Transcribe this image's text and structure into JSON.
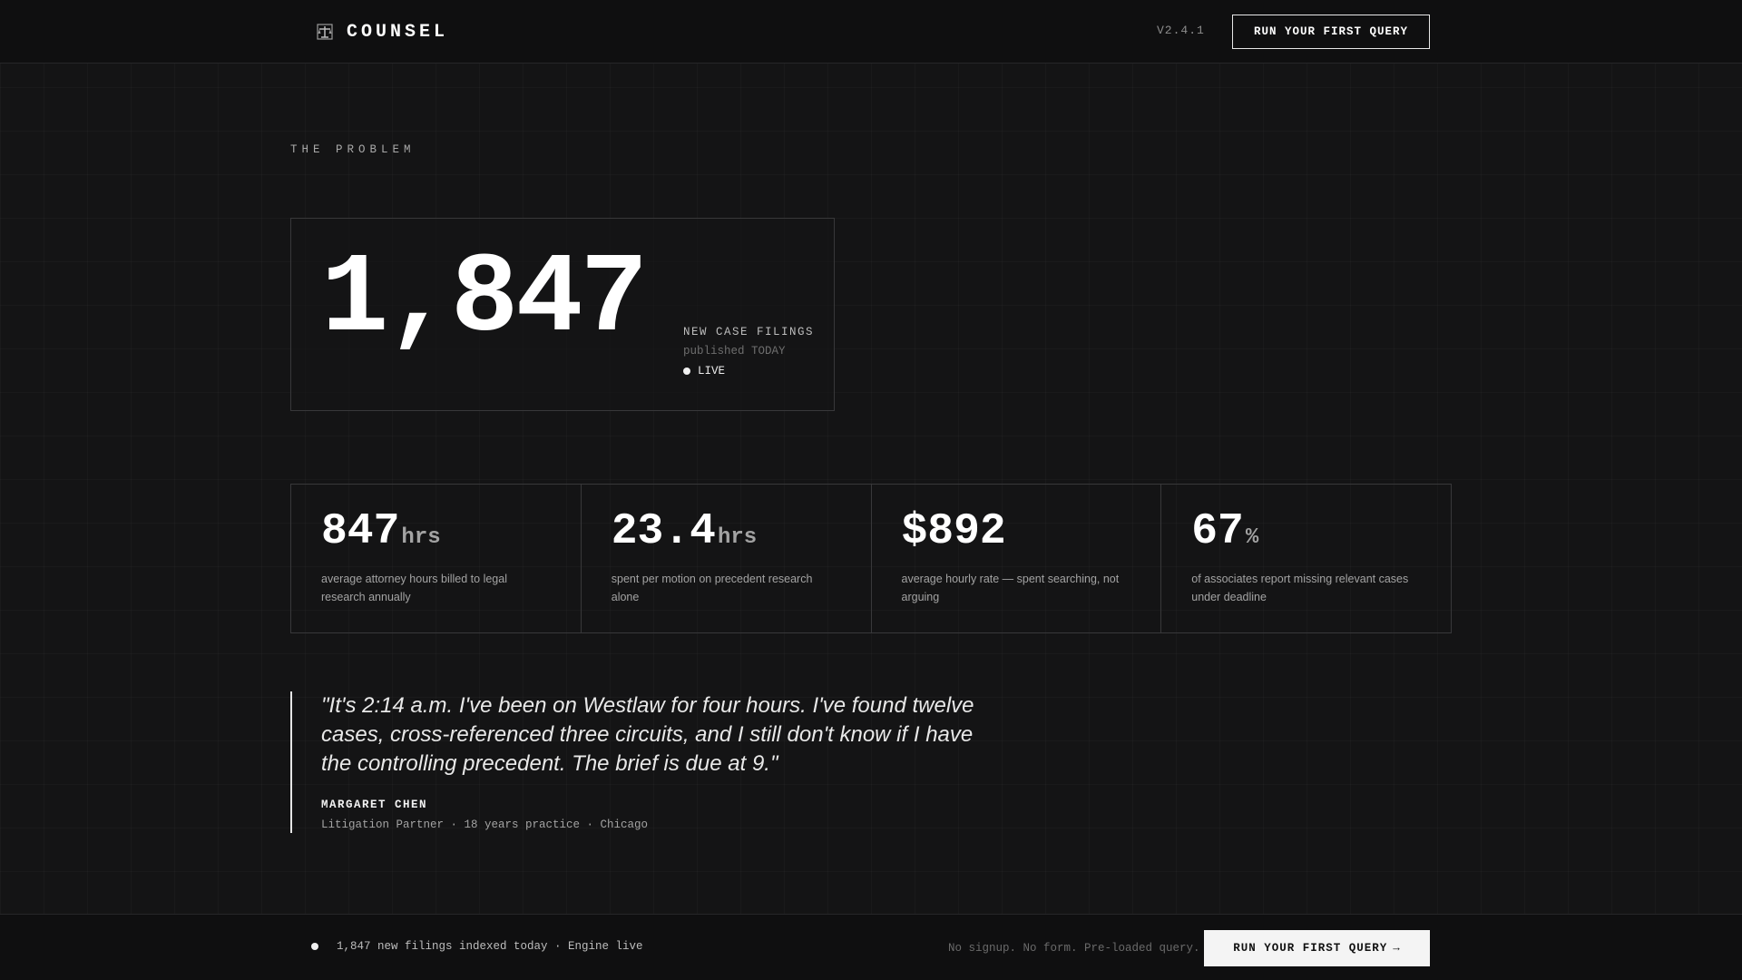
{
  "header": {
    "brand_name": "COUNSEL",
    "brand_icon": "scales-icon",
    "version": "V2.4.1",
    "cta_label": "RUN YOUR FIRST QUERY"
  },
  "problem": {
    "section_label": "THE PROBLEM",
    "hero": {
      "value": "1,847",
      "label": "NEW CASE FILINGS",
      "sub": "published TODAY",
      "live": "LIVE"
    },
    "stats": [
      {
        "value": "847",
        "unit": "hrs",
        "desc": "average attorney hours billed to legal research annually"
      },
      {
        "value": "23.4",
        "unit": "hrs",
        "desc": "spent per motion on precedent research alone"
      },
      {
        "value": "$892",
        "unit": "",
        "desc": "average hourly rate — spent searching, not arguing"
      },
      {
        "value": "67",
        "unit": "%",
        "desc": "of associates report missing relevant cases under deadline"
      }
    ],
    "testimonial": {
      "quote": "\"It's 2:14 a.m. I've been on Westlaw for four hours. I've found twelve cases, cross-referenced three circuits, and I still don't know if I have the controlling precedent. The brief is due at 9.\"",
      "author": "MARGARET CHEN",
      "role": "Litigation Partner · 18 years practice · Chicago"
    }
  },
  "footer": {
    "status": "1,847 new filings indexed today · Engine live",
    "note": "No signup. No form. Pre-loaded query.",
    "cta_label": "RUN YOUR FIRST QUERY",
    "cta_arrow": "→"
  },
  "colors": {
    "background": "#141415",
    "bar": "#0f0f10",
    "text": "#ffffff",
    "muted": "#a3a3a3",
    "border": "#38383a",
    "cta_fill": "#f4f4f4"
  }
}
